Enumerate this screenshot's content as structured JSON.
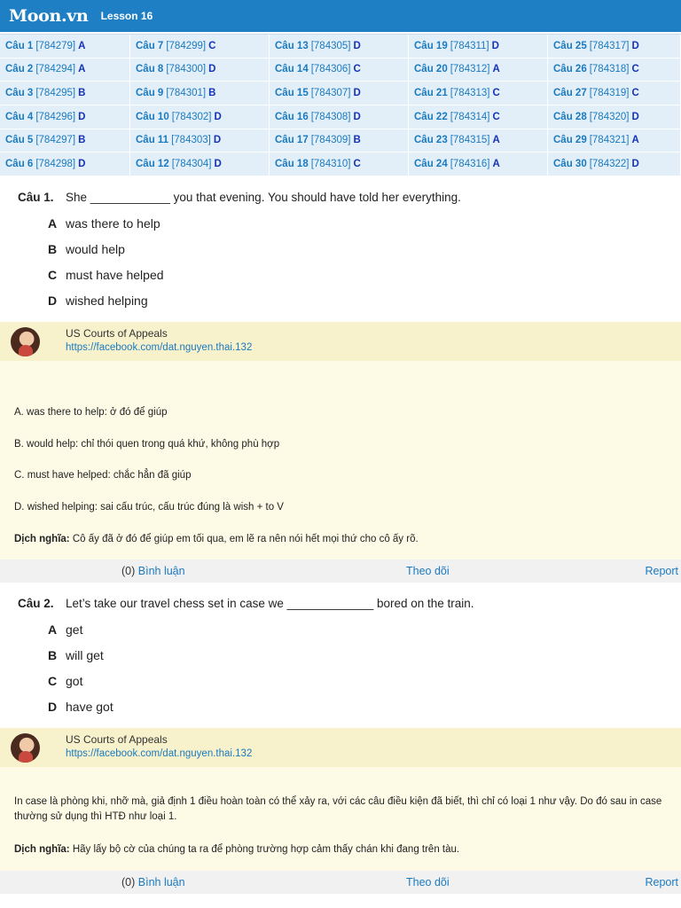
{
  "header": {
    "logo": "Moon.vn",
    "lesson": "Lesson 16"
  },
  "answer_grid": [
    [
      {
        "q": "Câu 1",
        "code": "[784279]",
        "ans": "A"
      },
      {
        "q": "Câu 7",
        "code": "[784299]",
        "ans": "C"
      },
      {
        "q": "Câu 13",
        "code": "[784305]",
        "ans": "D"
      },
      {
        "q": "Câu 19",
        "code": "[784311]",
        "ans": "D"
      },
      {
        "q": "Câu 25",
        "code": "[784317]",
        "ans": "D"
      }
    ],
    [
      {
        "q": "Câu 2",
        "code": "[784294]",
        "ans": "A"
      },
      {
        "q": "Câu 8",
        "code": "[784300]",
        "ans": "D"
      },
      {
        "q": "Câu 14",
        "code": "[784306]",
        "ans": "C"
      },
      {
        "q": "Câu 20",
        "code": "[784312]",
        "ans": "A"
      },
      {
        "q": "Câu 26",
        "code": "[784318]",
        "ans": "C"
      }
    ],
    [
      {
        "q": "Câu 3",
        "code": "[784295]",
        "ans": "B"
      },
      {
        "q": "Câu 9",
        "code": "[784301]",
        "ans": "B"
      },
      {
        "q": "Câu 15",
        "code": "[784307]",
        "ans": "D"
      },
      {
        "q": "Câu 21",
        "code": "[784313]",
        "ans": "C"
      },
      {
        "q": "Câu 27",
        "code": "[784319]",
        "ans": "C"
      }
    ],
    [
      {
        "q": "Câu 4",
        "code": "[784296]",
        "ans": "D"
      },
      {
        "q": "Câu 10",
        "code": "[784302]",
        "ans": "D"
      },
      {
        "q": "Câu 16",
        "code": "[784308]",
        "ans": "D"
      },
      {
        "q": "Câu 22",
        "code": "[784314]",
        "ans": "C"
      },
      {
        "q": "Câu 28",
        "code": "[784320]",
        "ans": "D"
      }
    ],
    [
      {
        "q": "Câu 5",
        "code": "[784297]",
        "ans": "B"
      },
      {
        "q": "Câu 11",
        "code": "[784303]",
        "ans": "D"
      },
      {
        "q": "Câu 17",
        "code": "[784309]",
        "ans": "B"
      },
      {
        "q": "Câu 23",
        "code": "[784315]",
        "ans": "A"
      },
      {
        "q": "Câu 29",
        "code": "[784321]",
        "ans": "A"
      }
    ],
    [
      {
        "q": "Câu 6",
        "code": "[784298]",
        "ans": "D"
      },
      {
        "q": "Câu 12",
        "code": "[784304]",
        "ans": "D"
      },
      {
        "q": "Câu 18",
        "code": "[784310]",
        "ans": "C"
      },
      {
        "q": "Câu 24",
        "code": "[784316]",
        "ans": "A"
      },
      {
        "q": "Câu 30",
        "code": "[784322]",
        "ans": "D"
      }
    ]
  ],
  "questions": [
    {
      "number": "Câu 1.",
      "text": "She ____________ you that evening. You should have told her everything.",
      "options": [
        {
          "letter": "A",
          "text": "was there to help"
        },
        {
          "letter": "B",
          "text": "would help"
        },
        {
          "letter": "C",
          "text": "must have helped"
        },
        {
          "letter": "D",
          "text": "wished helping"
        }
      ],
      "author": {
        "name": "US Courts of Appeals",
        "link": "https://facebook.com/dat.nguyen.thai.132",
        "avatar_icon": "user-avatar"
      },
      "explanation": [
        "A. was there to help: ở đó để giúp",
        "B. would help: chỉ thói quen trong quá khứ, không phù hợp",
        "C. must have helped: chắc hẳn đã giúp",
        "D. wished helping: sai cấu trúc, cấu trúc đúng là wish + to V"
      ],
      "translation_label": "Dịch nghĩa:",
      "translation": "Cô ấy đã ở đó để giúp em tối qua, em lẽ ra nên nói hết mọi thứ cho cô ấy rõ.",
      "footer": {
        "count": "(0)",
        "comment": "Bình luận",
        "follow": "Theo dõi",
        "report": "Report"
      }
    },
    {
      "number": "Câu 2.",
      "text": "Let’s take our travel chess set in case we _____________ bored on the train.",
      "options": [
        {
          "letter": "A",
          "text": "get"
        },
        {
          "letter": "B",
          "text": "will get"
        },
        {
          "letter": "C",
          "text": "got"
        },
        {
          "letter": "D",
          "text": "have got"
        }
      ],
      "author": {
        "name": "US Courts of Appeals",
        "link": "https://facebook.com/dat.nguyen.thai.132",
        "avatar_icon": "user-avatar"
      },
      "explanation_long": "In case là phòng khi, nhỡ mà, giả định 1 điều hoàn toàn có thể xảy ra, với các câu điều kiện đã biết, thì chỉ có loại 1 như vậy. Do đó sau in case thường sử dụng thì HTĐ như loại 1.",
      "translation_label": "Dịch nghĩa:",
      "translation": "Hãy lấy bộ cờ của chúng ta ra để phòng trường hợp cảm thấy chán khi đang trên tàu.",
      "footer": {
        "count": "(0)",
        "comment": "Bình luận",
        "follow": "Theo dõi",
        "report": "Report"
      }
    }
  ],
  "colors": {
    "header_bg": "#1f7fc4",
    "grid_bg": "#e3eff8",
    "author_bg": "#f7f1cc",
    "explain_bg": "#fdfbe6",
    "link": "#1a7ac0",
    "answer": "#1433b8"
  }
}
